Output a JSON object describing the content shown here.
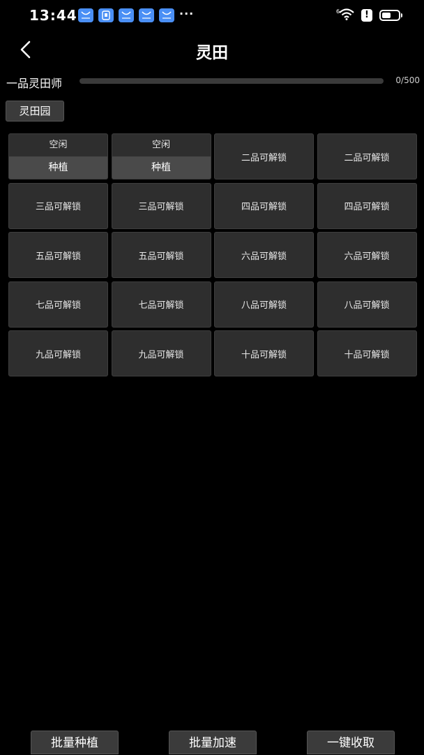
{
  "status_bar": {
    "time": "13:44",
    "more": "···",
    "alert": "!"
  },
  "header": {
    "title": "灵田"
  },
  "progress": {
    "rank_label": "一品灵田师",
    "current": 0,
    "max": 500,
    "text": "0/500"
  },
  "garden": {
    "tab_label": "灵田园"
  },
  "plots": [
    {
      "type": "idle",
      "status": "空闲",
      "action": "种植"
    },
    {
      "type": "idle",
      "status": "空闲",
      "action": "种植"
    },
    {
      "type": "locked",
      "label": "二品可解锁"
    },
    {
      "type": "locked",
      "label": "二品可解锁"
    },
    {
      "type": "locked",
      "label": "三品可解锁"
    },
    {
      "type": "locked",
      "label": "三品可解锁"
    },
    {
      "type": "locked",
      "label": "四品可解锁"
    },
    {
      "type": "locked",
      "label": "四品可解锁"
    },
    {
      "type": "locked",
      "label": "五品可解锁"
    },
    {
      "type": "locked",
      "label": "五品可解锁"
    },
    {
      "type": "locked",
      "label": "六品可解锁"
    },
    {
      "type": "locked",
      "label": "六品可解锁"
    },
    {
      "type": "locked",
      "label": "七品可解锁"
    },
    {
      "type": "locked",
      "label": "七品可解锁"
    },
    {
      "type": "locked",
      "label": "八品可解锁"
    },
    {
      "type": "locked",
      "label": "八品可解锁"
    },
    {
      "type": "locked",
      "label": "九品可解锁"
    },
    {
      "type": "locked",
      "label": "九品可解锁"
    },
    {
      "type": "locked",
      "label": "十品可解锁"
    },
    {
      "type": "locked",
      "label": "十品可解锁"
    }
  ],
  "actions": {
    "batch_plant": "批量种植",
    "batch_speedup": "批量加速",
    "harvest_all": "一键收取"
  },
  "icons": {
    "back": "chevron-left-icon",
    "wifi": "wifi-icon",
    "battery": "battery-icon",
    "notification": "app-notification-icon"
  },
  "colors": {
    "background": "#000000",
    "cell": "#2e2e2e",
    "button": "#3b3b3b",
    "notification_icon": "#4a8ff5"
  }
}
